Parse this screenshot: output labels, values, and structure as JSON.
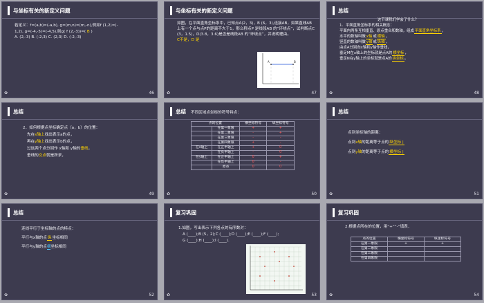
{
  "slides": {
    "s46": {
      "page": "46",
      "title": "与坐标有关的新定义问题",
      "line1": "若定义：f=(a,b)=(-a,b), g=(m,n)=(m,-n),例如f (1,2)=(-",
      "line2a": "1,2), g=(-4,-5)=(-4,5),则g( f (2,-3))=(",
      "line2ans": " B ",
      "line2b": ")",
      "options": "A. (2,-3)      B. (-2,3)      C. (2,3)      D. (-2,-3)"
    },
    "s47": {
      "page": "47",
      "title": "与坐标有关的新定义问题",
      "text": "如图，在平面直角坐标系中，已知点A(2，3)，B (6，3),连接AB，如果直线AB上有一个点与点P的距离不大于1，那么称点P 是线段AB 的“环绕点”，试判断点C (3，1.5)，D(3.8，3.6)是否是线段AB 的“环绕点”，并说明理由。",
      "answer": "C不是，D 是",
      "plot": {
        "pointA": "A",
        "pointB": "B"
      }
    },
    "s48": {
      "page": "48",
      "title": "总结",
      "question": "这节课我们学会了什么？",
      "l1": "1．平面直角坐标系的相关概念：",
      "l2a": "平面内两条互相垂直、原点重合和数轴，组成",
      "l2b": "平面直角坐标系",
      "l2c": "，",
      "l3a": "水平的数轴叫做",
      "l3b": "x轴",
      "l3c": "或",
      "l3d": "横轴",
      "l3e": "，",
      "l4a": "竖直的数轴叫做",
      "l4b": "y轴",
      "l4c": "或",
      "l4d": "纵轴",
      "l4e": "，",
      "l5": "由点A分别向x轴和y轴作垂线，",
      "l6a": "垂足M在x轴上的坐标就是点A的",
      "l6b": "横坐标",
      "l6c": "，",
      "l7a": "垂足N在y轴上的坐标就是点A的",
      "l7b": "纵坐标",
      "l7c": "。"
    },
    "s49": {
      "page": "49",
      "title": "总结",
      "l1": "2．如何根据点坐标确定点（a，b）的位置：",
      "l2a": "先在",
      "l2b": "x轴上",
      "l2c": "找出表示a的点，",
      "l3a": "再在",
      "l3b": "y轴上",
      "l3c": "找出表示b的点，",
      "l4a": "过这两个点分别作 x轴和 y轴的",
      "l4b": "垂线",
      "l4c": "，",
      "l5a": "垂线的",
      "l5b": "交点",
      "l5c": "就是所求，"
    },
    "s50": {
      "page": "50",
      "title": "总结",
      "subtitle": "不同区域点坐标的符号特点：",
      "headers": [
        "点的位置",
        "横坐标符号",
        "纵坐标符号"
      ],
      "rows": [
        [
          "",
          "在第一象限",
          "+",
          "+"
        ],
        [
          "",
          "在第二象限",
          "-",
          "+"
        ],
        [
          "",
          "在第三象限",
          "-",
          "-"
        ],
        [
          "",
          "在第四象限",
          "+",
          "-"
        ],
        [
          "在x轴上",
          "在正半轴上",
          "+",
          "0"
        ],
        [
          "",
          "在负半轴上",
          "-",
          "0"
        ],
        [
          "在y轴上",
          "在正半轴上",
          "0",
          "+"
        ],
        [
          "",
          "在负半轴上",
          "0",
          "-"
        ],
        [
          "",
          "原点",
          "0",
          "0"
        ]
      ]
    },
    "s51": {
      "page": "51",
      "title": "总结",
      "l1": "点到坐标轴的距离：",
      "l2a": "点到",
      "l2b": "x轴",
      "l2c": "的距离等于点的",
      "l2d": "纵坐标 |",
      "l3a": "点到",
      "l3b": "y轴",
      "l3c": "的距离等于点的",
      "l3d": "横坐标 |"
    },
    "s52": {
      "page": "52",
      "title": "总结",
      "l1": "连线平行于坐标轴的点的特点：",
      "l2a": "平行与x轴的点",
      "l2b": "纵",
      "l2c": "坐标相同",
      "l3a": "平行与y轴的点",
      "l3b": "横",
      "l3c": "坐标相同"
    },
    "s53": {
      "page": "53",
      "title": "复习巩固",
      "l1": "1.如图，写出表示下列各点的有序数对：",
      "l2": "A (____);B (5，2);C (____);D (____);E (____);F (____);",
      "l3": "G (____);H (____);I (____)."
    },
    "s54": {
      "page": "54",
      "title": "复习巩固",
      "l1": "2.根据点所在的位置，用“+”“-”填表．",
      "headers": [
        "点的位置",
        "横坐标符号",
        "纵坐标符号"
      ],
      "rows": [
        [
          "在第一象限",
          "+",
          "+"
        ],
        [
          "在第二象限",
          "",
          ""
        ],
        [
          "在第三象限",
          "",
          ""
        ],
        [
          "在第四象限",
          "",
          ""
        ]
      ]
    }
  },
  "colors": {
    "slide_bg": "#3d3b4f",
    "accent": "#ffd400",
    "page_bg": "#a9a9b1"
  },
  "icons": {
    "footer": "slide-footer-icon"
  }
}
